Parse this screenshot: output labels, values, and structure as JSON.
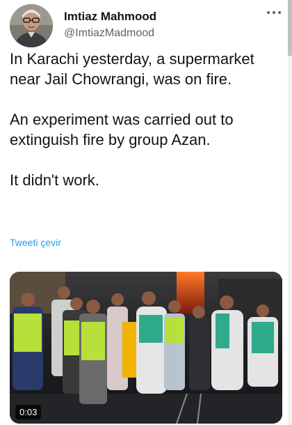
{
  "author": {
    "display_name": "Imtiaz Mahmood",
    "handle": "@ImtiazMadmood"
  },
  "tweet": {
    "paragraphs": [
      "In Karachi yesterday, a supermarket near Jail Chowrangi, was on fire.",
      "An experiment was carried out to extinguish fire by group Azan.",
      "It didn't work."
    ],
    "translate_label": "Tweeti çevir"
  },
  "media": {
    "duration": "0:03"
  },
  "colors": {
    "accent": "#1d9bf0",
    "text": "#0f1419",
    "secondary": "#536471"
  }
}
